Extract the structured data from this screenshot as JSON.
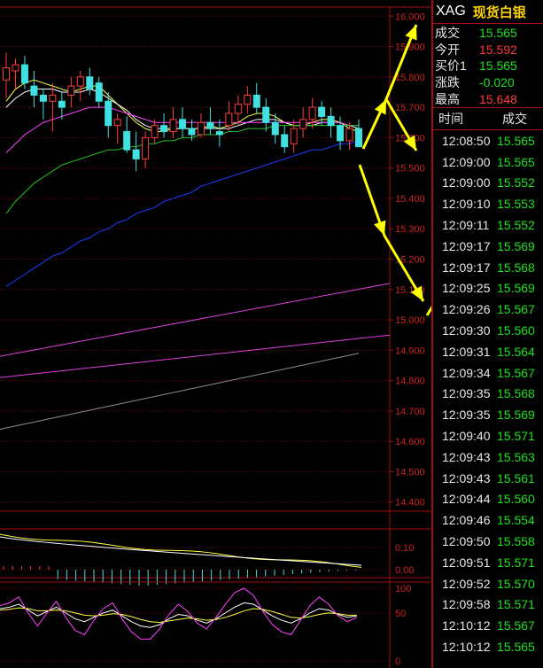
{
  "symbol": "XAG",
  "name": "现货白银",
  "quotes": [
    {
      "label": "成交",
      "value": "15.565",
      "color": "#1ee11e"
    },
    {
      "label": "今开",
      "value": "15.592",
      "color": "#ff3c3c"
    },
    {
      "label": "买价1",
      "value": "15.565",
      "color": "#1ee11e"
    },
    {
      "label": "涨跌",
      "value": "-0.020",
      "color": "#1ee11e"
    },
    {
      "label": "最高",
      "value": "15.648",
      "color": "#ff3c3c"
    }
  ],
  "ticks_header": {
    "time": "时间",
    "price": "成交"
  },
  "ticks": [
    {
      "time": "12:08:50",
      "price": "15.565"
    },
    {
      "time": "12:09:00",
      "price": "15.565"
    },
    {
      "time": "12:09:00",
      "price": "15.552"
    },
    {
      "time": "12:09:10",
      "price": "15.553"
    },
    {
      "time": "12:09:11",
      "price": "15.552"
    },
    {
      "time": "12:09:17",
      "price": "15.569"
    },
    {
      "time": "12:09:17",
      "price": "15.568"
    },
    {
      "time": "12:09:25",
      "price": "15.569"
    },
    {
      "time": "12:09:26",
      "price": "15.567"
    },
    {
      "time": "12:09:30",
      "price": "15.560"
    },
    {
      "time": "12:09:31",
      "price": "15.564"
    },
    {
      "time": "12:09:34",
      "price": "15.567"
    },
    {
      "time": "12:09:35",
      "price": "15.568"
    },
    {
      "time": "12:09:35",
      "price": "15.569"
    },
    {
      "time": "12:09:40",
      "price": "15.571"
    },
    {
      "time": "12:09:43",
      "price": "15.563"
    },
    {
      "time": "12:09:43",
      "price": "15.561"
    },
    {
      "time": "12:09:44",
      "price": "15.560"
    },
    {
      "time": "12:09:46",
      "price": "15.554"
    },
    {
      "time": "12:09:50",
      "price": "15.558"
    },
    {
      "time": "12:09:51",
      "price": "15.571"
    },
    {
      "time": "12:09:52",
      "price": "15.570"
    },
    {
      "time": "12:09:58",
      "price": "15.571"
    },
    {
      "time": "12:10:12",
      "price": "15.567"
    },
    {
      "time": "12:10:12",
      "price": "15.565"
    }
  ],
  "chart_data": {
    "type": "candlestick",
    "price_axis_labels": [
      "16.000",
      "15.900",
      "15.800",
      "15.700",
      "15.600",
      "15.500",
      "15.400",
      "15.300",
      "15.200",
      "15.100",
      "15.000",
      "14.900",
      "14.800",
      "14.700",
      "14.600",
      "14.500",
      "14.400"
    ],
    "ylim": [
      14.37,
      16.03
    ],
    "indicator1_axis_labels": [
      "0.10",
      "0.00"
    ],
    "indicator2_axis_labels": [
      "100",
      "50",
      "0"
    ],
    "candles": [
      [
        15.79,
        15.88,
        15.73,
        15.83
      ],
      [
        15.82,
        15.86,
        15.76,
        15.84
      ],
      [
        15.84,
        15.87,
        15.76,
        15.78
      ],
      [
        15.77,
        15.82,
        15.7,
        15.74
      ],
      [
        15.74,
        15.76,
        15.66,
        15.72
      ],
      [
        15.72,
        15.78,
        15.62,
        15.74
      ],
      [
        15.72,
        15.75,
        15.66,
        15.7
      ],
      [
        15.74,
        15.8,
        15.7,
        15.77
      ],
      [
        15.77,
        15.82,
        15.72,
        15.8
      ],
      [
        15.8,
        15.83,
        15.74,
        15.76
      ],
      [
        15.78,
        15.8,
        15.7,
        15.72
      ],
      [
        15.72,
        15.75,
        15.6,
        15.64
      ],
      [
        15.64,
        15.68,
        15.58,
        15.66
      ],
      [
        15.62,
        15.67,
        15.55,
        15.56
      ],
      [
        15.56,
        15.62,
        15.49,
        15.53
      ],
      [
        15.53,
        15.62,
        15.5,
        15.6
      ],
      [
        15.6,
        15.66,
        15.58,
        15.64
      ],
      [
        15.64,
        15.68,
        15.6,
        15.62
      ],
      [
        15.62,
        15.7,
        15.6,
        15.66
      ],
      [
        15.66,
        15.7,
        15.6,
        15.63
      ],
      [
        15.63,
        15.66,
        15.59,
        15.61
      ],
      [
        15.61,
        15.68,
        15.6,
        15.65
      ],
      [
        15.65,
        15.7,
        15.61,
        15.63
      ],
      [
        15.62,
        15.66,
        15.57,
        15.61
      ],
      [
        15.64,
        15.72,
        15.62,
        15.68
      ],
      [
        15.68,
        15.74,
        15.64,
        15.71
      ],
      [
        15.71,
        15.77,
        15.68,
        15.74
      ],
      [
        15.74,
        15.78,
        15.68,
        15.7
      ],
      [
        15.7,
        15.73,
        15.62,
        15.65
      ],
      [
        15.65,
        15.68,
        15.58,
        15.61
      ],
      [
        15.61,
        15.64,
        15.55,
        15.57
      ],
      [
        15.58,
        15.66,
        15.55,
        15.63
      ],
      [
        15.63,
        15.7,
        15.6,
        15.66
      ],
      [
        15.66,
        15.73,
        15.63,
        15.7
      ],
      [
        15.7,
        15.72,
        15.64,
        15.67
      ],
      [
        15.67,
        15.7,
        15.6,
        15.64
      ],
      [
        15.64,
        15.67,
        15.56,
        15.59
      ],
      [
        15.59,
        15.65,
        15.56,
        15.63
      ],
      [
        15.63,
        15.66,
        15.58,
        15.57
      ]
    ],
    "ma_lines": [
      {
        "color": "#ffff40",
        "values": [
          15.72,
          15.76,
          15.78,
          15.79,
          15.78,
          15.77,
          15.76,
          15.75,
          15.76,
          15.77,
          15.77,
          15.74,
          15.71,
          15.68,
          15.65,
          15.63,
          15.62,
          15.62,
          15.63,
          15.63,
          15.63,
          15.63,
          15.64,
          15.63,
          15.64,
          15.65,
          15.67,
          15.68,
          15.68,
          15.67,
          15.65,
          15.64,
          15.64,
          15.65,
          15.66,
          15.66,
          15.65,
          15.63,
          15.62
        ]
      },
      {
        "color": "#ffffff",
        "values": [
          15.7,
          15.73,
          15.75,
          15.76,
          15.76,
          15.76,
          15.75,
          15.75,
          15.75,
          15.76,
          15.75,
          15.73,
          15.71,
          15.69,
          15.66,
          15.64,
          15.63,
          15.63,
          15.63,
          15.63,
          15.63,
          15.63,
          15.63,
          15.63,
          15.63,
          15.64,
          15.65,
          15.66,
          15.66,
          15.66,
          15.65,
          15.64,
          15.64,
          15.64,
          15.65,
          15.65,
          15.65,
          15.64,
          15.63
        ]
      },
      {
        "color": "#ff40ff",
        "values": [
          15.55,
          15.58,
          15.61,
          15.63,
          15.65,
          15.66,
          15.67,
          15.68,
          15.69,
          15.7,
          15.7,
          15.7,
          15.69,
          15.68,
          15.67,
          15.66,
          15.65,
          15.65,
          15.65,
          15.65,
          15.65,
          15.65,
          15.65,
          15.65,
          15.65,
          15.65,
          15.65,
          15.65,
          15.65,
          15.65,
          15.65,
          15.65,
          15.65,
          15.65,
          15.65,
          15.65,
          15.65,
          15.64,
          15.64
        ]
      },
      {
        "color": "#20c020",
        "values": [
          15.35,
          15.39,
          15.42,
          15.45,
          15.47,
          15.49,
          15.51,
          15.52,
          15.53,
          15.54,
          15.55,
          15.56,
          15.56,
          15.57,
          15.57,
          15.58,
          15.58,
          15.59,
          15.59,
          15.6,
          15.6,
          15.61,
          15.61,
          15.61,
          15.62,
          15.62,
          15.63,
          15.63,
          15.63,
          15.64,
          15.64,
          15.64,
          15.64,
          15.64,
          15.64,
          15.64,
          15.64,
          15.64,
          15.64
        ]
      },
      {
        "color": "#1e3cff",
        "values": [
          15.11,
          15.13,
          15.15,
          15.17,
          15.19,
          15.21,
          15.22,
          15.24,
          15.26,
          15.27,
          15.29,
          15.3,
          15.32,
          15.33,
          15.35,
          15.36,
          15.37,
          15.39,
          15.4,
          15.41,
          15.42,
          15.44,
          15.45,
          15.46,
          15.47,
          15.48,
          15.49,
          15.5,
          15.51,
          15.52,
          15.53,
          15.54,
          15.55,
          15.56,
          15.56,
          15.57,
          15.58,
          15.58,
          15.59
        ]
      }
    ],
    "long_lines": [
      {
        "color": "#e040e0",
        "from": [
          0,
          14.88
        ],
        "to": [
          440,
          15.12
        ]
      },
      {
        "color": "#e040e0",
        "from": [
          0,
          14.81
        ],
        "to": [
          440,
          14.95
        ]
      },
      {
        "color": "#909090",
        "from": [
          0,
          14.64
        ],
        "to": [
          405,
          14.89
        ]
      }
    ]
  }
}
